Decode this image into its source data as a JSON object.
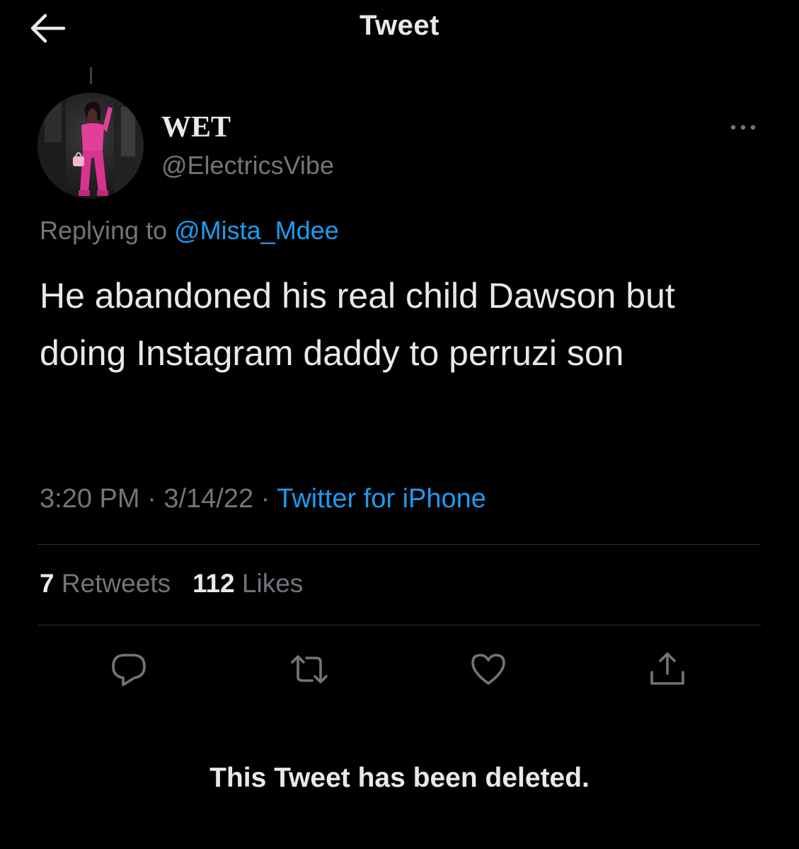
{
  "header": {
    "title": "Tweet",
    "back_icon": "arrow-left-icon"
  },
  "tweet": {
    "author": {
      "display_name": "WET",
      "handle": "@ElectricsVibe"
    },
    "more_icon": "more-horizontal-icon",
    "reply_context": {
      "prefix": "Replying to",
      "mention": "@Mista_Mdee"
    },
    "text": "He abandoned his real child Dawson but doing Instagram daddy to perruzi son",
    "time": "3:20 PM",
    "separator": "·",
    "date": "3/14/22",
    "source": "Twitter for iPhone",
    "stats": {
      "retweets_count": "7",
      "retweets_label": "Retweets",
      "likes_count": "112",
      "likes_label": "Likes"
    },
    "actions": {
      "reply_icon": "reply-icon",
      "retweet_icon": "retweet-icon",
      "like_icon": "heart-icon",
      "share_icon": "share-icon"
    }
  },
  "deleted_notice": "This Tweet has been deleted.",
  "colors": {
    "background": "#000000",
    "text_primary": "#e7e9ea",
    "text_secondary": "#71767b",
    "accent": "#1d9bf0",
    "divider": "#2f3336"
  }
}
